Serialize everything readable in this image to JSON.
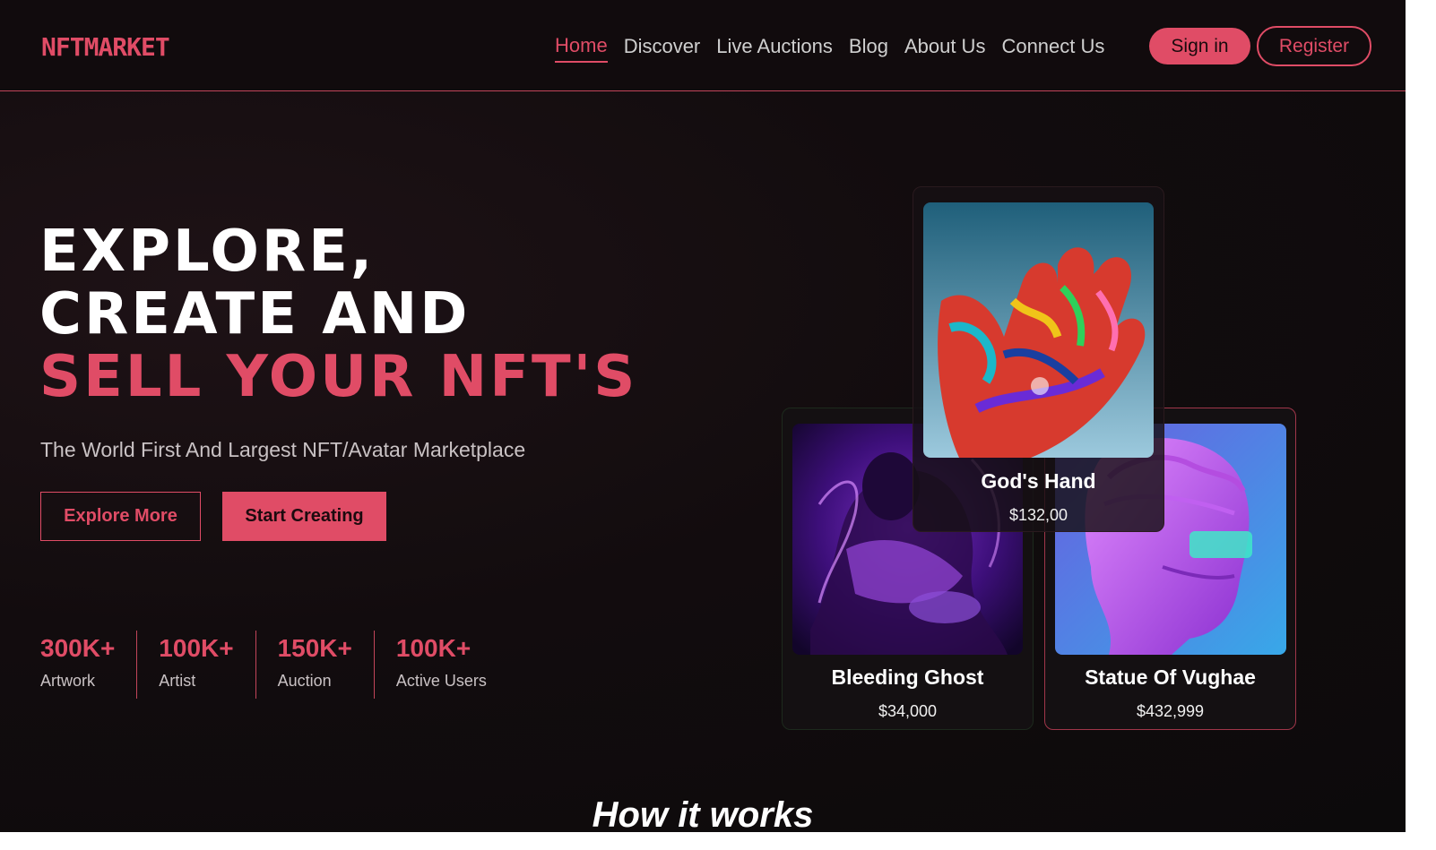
{
  "brand": {
    "logo": "NFTMARKET",
    "accent_color": "#e04c66"
  },
  "nav": {
    "items": [
      "Home",
      "Discover",
      "Live Auctions",
      "Blog",
      "About Us",
      "Connect Us"
    ],
    "active": "Home",
    "signin_label": "Sign in",
    "register_label": "Register"
  },
  "hero": {
    "title_line1": "EXPLORE,",
    "title_line2": "CREATE AND",
    "title_line3": "SELL YOUR NFT'S",
    "subtitle": "The World First And Largest NFT/Avatar Marketplace",
    "explore_label": "Explore More",
    "start_label": "Start Creating"
  },
  "stats": [
    {
      "value": "300K+",
      "label": "Artwork"
    },
    {
      "value": "100K+",
      "label": "Artist"
    },
    {
      "value": "150K+",
      "label": "Auction"
    },
    {
      "value": "100K+",
      "label": "Active Users"
    }
  ],
  "cards": {
    "hand": {
      "name": "God's Hand",
      "price": "$132,00"
    },
    "ghost": {
      "name": "Bleeding Ghost",
      "price": "$34,000"
    },
    "statue": {
      "name": "Statue Of Vughae",
      "price": "$432,999"
    }
  },
  "section": {
    "how_title": "How it works"
  }
}
